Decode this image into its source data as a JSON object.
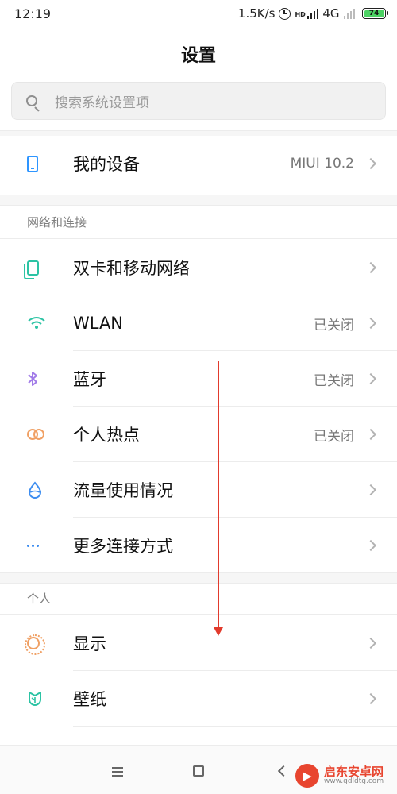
{
  "status_bar": {
    "time": "12:19",
    "network_speed": "1.5K/s",
    "network_type": "4G",
    "hd": "HD",
    "battery": "74"
  },
  "header": {
    "title": "设置"
  },
  "search": {
    "placeholder": "搜索系统设置项"
  },
  "device": {
    "label": "我的设备",
    "value": "MIUI 10.2"
  },
  "sections": {
    "network": {
      "title": "网络和连接",
      "items": [
        {
          "label": "双卡和移动网络",
          "value": "",
          "icon": "dual-sim-icon"
        },
        {
          "label": "WLAN",
          "value": "已关闭",
          "icon": "wifi-icon"
        },
        {
          "label": "蓝牙",
          "value": "已关闭",
          "icon": "bluetooth-icon"
        },
        {
          "label": "个人热点",
          "value": "已关闭",
          "icon": "hotspot-icon"
        },
        {
          "label": "流量使用情况",
          "value": "",
          "icon": "data-usage-icon"
        },
        {
          "label": "更多连接方式",
          "value": "",
          "icon": "more-dots-icon"
        }
      ]
    },
    "personal": {
      "title": "个人",
      "items": [
        {
          "label": "显示",
          "icon": "display-brightness-icon"
        },
        {
          "label": "壁纸",
          "icon": "wallpaper-icon"
        }
      ]
    }
  },
  "colors": {
    "device_icon": "#2e95ff",
    "sim_icon": "#2cc3a4",
    "wifi_icon": "#2cc3a4",
    "bluetooth_icon": "#a17be8",
    "hotspot_icon": "#f0a064",
    "data_icon": "#3d8df0",
    "display_icon": "#f0a064",
    "wallpaper_icon": "#2cc3a4",
    "annotation_arrow": "#e23a2c"
  },
  "watermark": {
    "name": "启东安卓网",
    "url": "www.qdldtg.com"
  }
}
